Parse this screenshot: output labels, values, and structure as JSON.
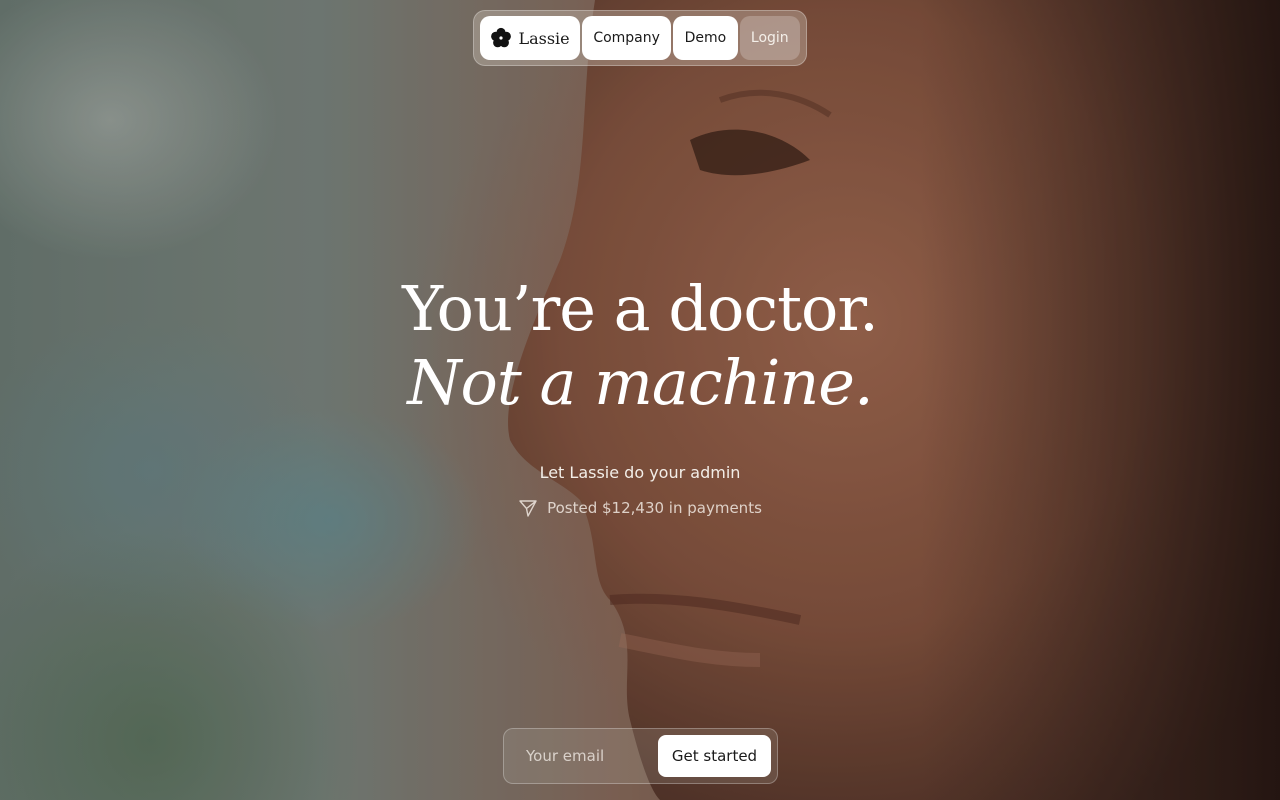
{
  "nav": {
    "logo_text": "Lassie",
    "logo_icon": "flower-icon",
    "items": [
      {
        "label": "Company"
      },
      {
        "label": "Demo"
      },
      {
        "label": "Login"
      }
    ]
  },
  "hero": {
    "headline_line1": "You’re a doctor.",
    "headline_line2": "Not a machine.",
    "subtitle": "Let Lassie do your admin",
    "activity_icon": "paper-plane-icon",
    "activity_text": "Posted $12,430 in payments"
  },
  "signup": {
    "email_placeholder": "Your email",
    "email_value": "",
    "button_label": "Get started"
  },
  "colors": {
    "text_primary": "#ffffff",
    "button_bg": "#ffffff",
    "button_text": "#1a1a1a"
  }
}
